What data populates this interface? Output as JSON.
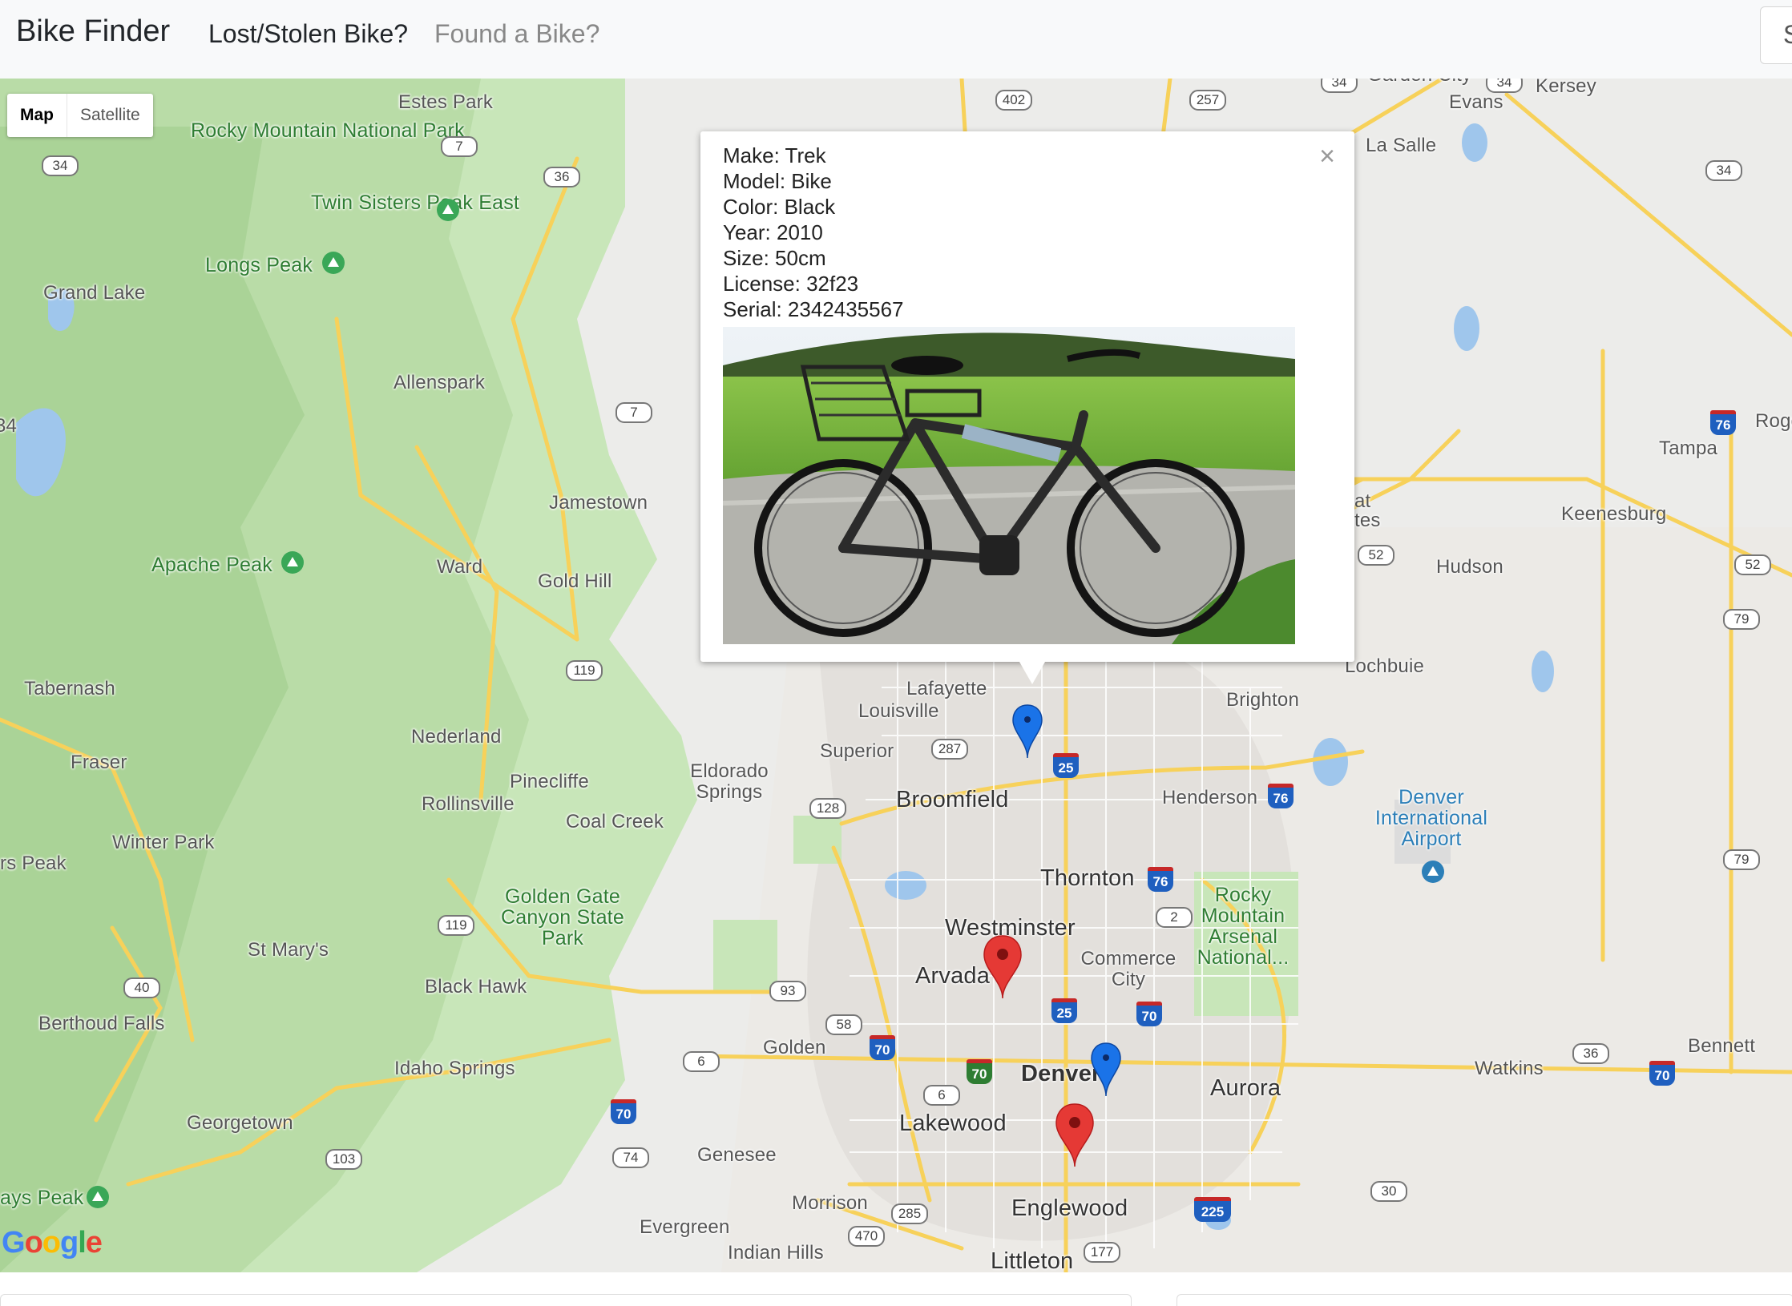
{
  "navbar": {
    "brand": "Bike Finder",
    "links": [
      {
        "label": "Lost/Stolen Bike?"
      },
      {
        "label": "Found a Bike?"
      }
    ],
    "search_partial": "S"
  },
  "map": {
    "map_type": {
      "map": "Map",
      "satellite": "Satellite"
    },
    "attribution": "Google",
    "places": [
      {
        "name": "Estes Park",
        "kind": "town"
      },
      {
        "name": "Rocky Mountain National Park",
        "kind": "park"
      },
      {
        "name": "Twin Sisters Peak East",
        "kind": "park"
      },
      {
        "name": "Longs Peak",
        "kind": "park"
      },
      {
        "name": "Grand Lake",
        "kind": "town"
      },
      {
        "name": "Allenspark",
        "kind": "town"
      },
      {
        "name": "Jamestown",
        "kind": "town"
      },
      {
        "name": "Apache Peak",
        "kind": "park"
      },
      {
        "name": "Ward",
        "kind": "town"
      },
      {
        "name": "Gold Hill",
        "kind": "town"
      },
      {
        "name": "Tabernash",
        "kind": "town"
      },
      {
        "name": "Nederland",
        "kind": "town"
      },
      {
        "name": "Fraser",
        "kind": "town"
      },
      {
        "name": "Pinecliffe",
        "kind": "town"
      },
      {
        "name": "Rollinsville",
        "kind": "town"
      },
      {
        "name": "Coal Creek",
        "kind": "town"
      },
      {
        "name": "Eldorado Springs",
        "kind": "town"
      },
      {
        "name": "Winter Park",
        "kind": "town"
      },
      {
        "name": "rs Peak",
        "kind": "town"
      },
      {
        "name": "Golden Gate Canyon State Park",
        "kind": "park"
      },
      {
        "name": "St Mary's",
        "kind": "town"
      },
      {
        "name": "Black Hawk",
        "kind": "town"
      },
      {
        "name": "Berthoud Falls",
        "kind": "town"
      },
      {
        "name": "Idaho Springs",
        "kind": "town"
      },
      {
        "name": "Georgetown",
        "kind": "town"
      },
      {
        "name": "ays Peak",
        "kind": "park"
      },
      {
        "name": "Evergreen",
        "kind": "town"
      },
      {
        "name": "Indian Hills",
        "kind": "town"
      },
      {
        "name": "Genesee",
        "kind": "town"
      },
      {
        "name": "Morrison",
        "kind": "town"
      },
      {
        "name": "Golden",
        "kind": "town"
      },
      {
        "name": "Lakewood",
        "kind": "city"
      },
      {
        "name": "Englewood",
        "kind": "city"
      },
      {
        "name": "Littleton",
        "kind": "city"
      },
      {
        "name": "Arvada",
        "kind": "city"
      },
      {
        "name": "Westminster",
        "kind": "city"
      },
      {
        "name": "Thornton",
        "kind": "city"
      },
      {
        "name": "Broomfield",
        "kind": "city"
      },
      {
        "name": "Superior",
        "kind": "town"
      },
      {
        "name": "Louisville",
        "kind": "town"
      },
      {
        "name": "Lafayette",
        "kind": "town"
      },
      {
        "name": "Commerce City",
        "kind": "town"
      },
      {
        "name": "Rocky Mountain Arsenal National...",
        "kind": "park"
      },
      {
        "name": "Denver",
        "kind": "city"
      },
      {
        "name": "Aurora",
        "kind": "city"
      },
      {
        "name": "Henderson",
        "kind": "town"
      },
      {
        "name": "Brighton",
        "kind": "town"
      },
      {
        "name": "Lochbuie",
        "kind": "town"
      },
      {
        "name": "Denver International Airport",
        "kind": "airport"
      },
      {
        "name": "Hudson",
        "kind": "town"
      },
      {
        "name": "Keenesburg",
        "kind": "town"
      },
      {
        "name": "Tampa",
        "kind": "town"
      },
      {
        "name": "Rogg",
        "kind": "town"
      },
      {
        "name": "Evans",
        "kind": "town"
      },
      {
        "name": "La Salle",
        "kind": "town"
      },
      {
        "name": "Kersey",
        "kind": "town"
      },
      {
        "name": "Garden City",
        "kind": "town"
      },
      {
        "name": "Bennett",
        "kind": "town"
      },
      {
        "name": "Watkins",
        "kind": "town"
      },
      {
        "name": "at",
        "kind": "town"
      },
      {
        "name": "tes",
        "kind": "town"
      },
      {
        "name": "34",
        "kind": "town"
      }
    ],
    "route_shields": [
      "34",
      "7",
      "36",
      "7",
      "119",
      "119",
      "40",
      "6",
      "103",
      "74",
      "70",
      "6",
      "93",
      "58",
      "70",
      "70",
      "128",
      "287",
      "25",
      "76",
      "2",
      "25",
      "70",
      "76",
      "285",
      "470",
      "177",
      "225",
      "30",
      "36",
      "70",
      "79",
      "79",
      "52",
      "52",
      "76",
      "34",
      "402",
      "257",
      "34",
      "34",
      "34"
    ],
    "pins": [
      {
        "color": "#1a73e8",
        "kind": "found"
      },
      {
        "color": "#1a73e8",
        "kind": "found"
      },
      {
        "color": "#e53935",
        "kind": "lost"
      },
      {
        "color": "#e53935",
        "kind": "lost"
      }
    ]
  },
  "info_window": {
    "lines": [
      "Make: Trek",
      "Model: Bike",
      "Color: Black",
      "Year: 2010",
      "Size: 50cm",
      "License: 32f23",
      "Serial: 2342435567"
    ],
    "close_symbol": "×"
  }
}
